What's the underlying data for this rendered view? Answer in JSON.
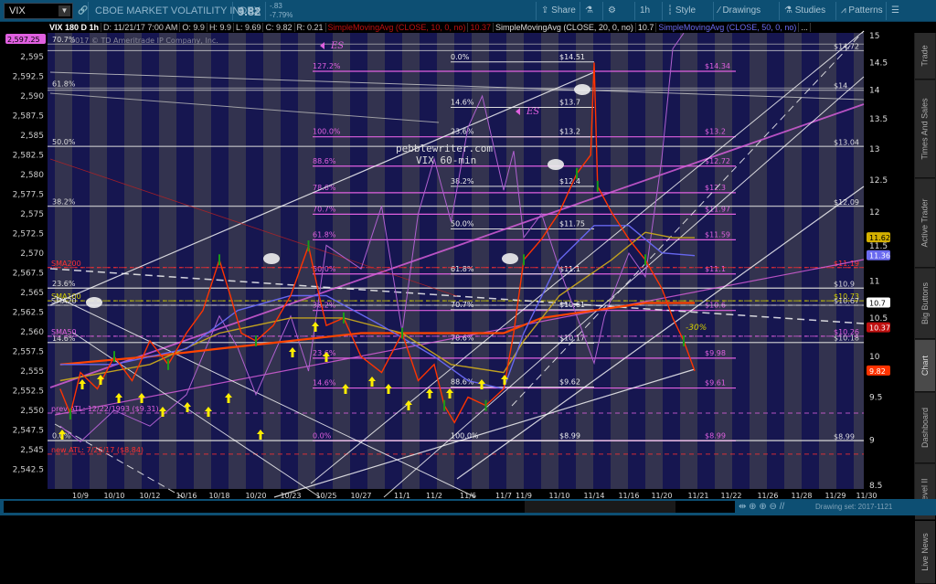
{
  "header": {
    "symbol": "VIX",
    "name": "CBOE MARKET VOLATILITY INDEX",
    "last": "9.82",
    "change": "-.83",
    "change_pct": "-7.79%",
    "buttons": [
      {
        "label": "Share",
        "icon": "share-icon"
      },
      {
        "label": "",
        "icon": "flask-icon"
      },
      {
        "label": "",
        "icon": "gear-icon"
      },
      {
        "label": "1h",
        "icon": ""
      },
      {
        "label": "Style",
        "icon": "candle-icon"
      },
      {
        "label": "Drawings",
        "icon": "pencil-icon"
      },
      {
        "label": "Studies",
        "icon": "flask-icon"
      },
      {
        "label": "Patterns",
        "icon": "pattern-icon"
      },
      {
        "label": "",
        "icon": "menu-icon"
      }
    ]
  },
  "infobar": {
    "title": "VIX 180 D 1h",
    "date": "D: 11/21/17 7:00 AM",
    "open": "O: 9.9",
    "high": "H: 9.9",
    "low": "L: 9.69",
    "close": "C: 9.82",
    "range": "R: 0.21",
    "study1": "SimpleMovingAvg (CLOSE, 10, 0, no)",
    "study1_val": "10.37",
    "study2": "SimpleMovingAvg (CLOSE, 20, 0, no)",
    "study2_val": "10.7",
    "study3": "SimpleMovingAvg (CLOSE, 50, 0, no)",
    "more": "..."
  },
  "copyright": "2017 © TD Ameritrade IP Company, Inc.",
  "sidebar": {
    "tabs": [
      "Trade",
      "Times And Sales",
      "Active Trader",
      "Big Buttons",
      "Chart",
      "Dashboard",
      "Level II",
      "Live News"
    ],
    "selected": "Chart"
  },
  "footer": {
    "drawing_set": "Drawing set: 2017-1121"
  },
  "colors": {
    "bg": "#1a1a4a",
    "stripe": "#33334f",
    "magenta": "#e060e0",
    "fib": "#dddddd",
    "price": "#ff3300",
    "sma10": "#cc1111",
    "sma20": "#cccccc",
    "sma50": "#6666ee",
    "sma100": "#c0a020"
  },
  "chart_data": {
    "type": "line",
    "title": "pebblewriter.com",
    "subtitle": "VIX 60-min",
    "right_axis": {
      "label": "VIX",
      "ticks": [
        "15",
        "14.5",
        "14",
        "13.5",
        "13",
        "12.5",
        "12",
        "11.5",
        "11",
        "10.5",
        "10",
        "9.5",
        "9",
        "8.5"
      ],
      "range": [
        8.5,
        15
      ],
      "scale": "log"
    },
    "left_axis": {
      "label": "ES",
      "ticks": [
        "2,595",
        "2,592.5",
        "2,590",
        "2,587.5",
        "2,585",
        "2,582.5",
        "2,580",
        "2,577.5",
        "2,575",
        "2,572.5",
        "2,570",
        "2,567.5",
        "2,565",
        "2,562.5",
        "2,560",
        "2,557.5",
        "2,555",
        "2,552.5",
        "2,550",
        "2,547.5",
        "2,545",
        "2,542.5"
      ],
      "range": [
        2542.5,
        2597.25
      ]
    },
    "x_ticks": [
      "10/9",
      "10/10",
      "10/12",
      "10/16",
      "10/18",
      "10/20",
      "10/23",
      "10/25",
      "10/27",
      "11/1",
      "11/2",
      "11/6",
      "11/7",
      "11/9",
      "11/10",
      "11/14",
      "11/16",
      "11/20",
      "11/21",
      "11/22",
      "11/26",
      "11/28",
      "11/29",
      "11/30"
    ],
    "badges": [
      {
        "text": "11.62",
        "v": 11.62,
        "color": "#d4b000",
        "fg": "#000"
      },
      {
        "text": "11.36",
        "v": 11.36,
        "color": "#6a6af0",
        "fg": "#fff"
      },
      {
        "text": "10.7",
        "v": 10.7,
        "color": "#ffffff",
        "fg": "#000"
      },
      {
        "text": "10.37",
        "v": 10.37,
        "color": "#c01010",
        "fg": "#fff"
      },
      {
        "text": "9.82",
        "v": 9.82,
        "color": "#ff3300",
        "fg": "#fff"
      }
    ],
    "left_badge": "2,597.25",
    "vix_fib": [
      {
        "pct": "0.0%",
        "price": "$14.51",
        "v": 14.51
      },
      {
        "pct": "14.6%",
        "price": "$13.7",
        "v": 13.7
      },
      {
        "pct": "23.6%",
        "price": "$13.2",
        "v": 13.2
      },
      {
        "pct": "38.2%",
        "price": "$12.4",
        "v": 12.4
      },
      {
        "pct": "50.0%",
        "price": "$11.75",
        "v": 11.75
      },
      {
        "pct": "61.8%",
        "price": "$11.1",
        "v": 11.1
      },
      {
        "pct": "70.7%",
        "price": "$10.61",
        "v": 10.61
      },
      {
        "pct": "78.6%",
        "price": "$10.17",
        "v": 10.17
      },
      {
        "pct": "88.6%",
        "price": "$9.62",
        "v": 9.62
      },
      {
        "pct": "100.0%",
        "price": "$8.99",
        "v": 8.99
      }
    ],
    "es_fib_ext": [
      {
        "pct": "127.2%",
        "price": "$14.34",
        "v": 14.34
      },
      {
        "pct": "100.0%",
        "price": "$13.2",
        "v": 13.2
      },
      {
        "pct": "88.6%",
        "price": "$12.72",
        "v": 12.72
      },
      {
        "pct": "78.6%",
        "price": "$12.3",
        "v": 12.3
      },
      {
        "pct": "70.7%",
        "price": "$11.97",
        "v": 11.97
      },
      {
        "pct": "61.8%",
        "price": "$11.59",
        "v": 11.59
      },
      {
        "pct": "50.0%",
        "price": "$11.1",
        "v": 11.1
      },
      {
        "pct": "38.2%",
        "price": "$10.6",
        "v": 10.6
      },
      {
        "pct": "23.6%",
        "price": "$9.98",
        "v": 9.98
      },
      {
        "pct": "14.6%",
        "price": "$9.61",
        "v": 9.61
      },
      {
        "pct": "0.0%",
        "price": "$8.99",
        "v": 8.99
      }
    ],
    "es_fib_left": [
      {
        "pct": "70.7%",
        "es": 2596.6
      },
      {
        "pct": "61.8%",
        "es": 2591
      },
      {
        "pct": "50.0%",
        "es": 2583.6
      },
      {
        "pct": "38.2%",
        "es": 2576
      },
      {
        "pct": "23.6%",
        "es": 2565.6
      },
      {
        "pct": "14.6%",
        "es": 2558.6
      },
      {
        "pct": "0.0%",
        "es": 2546.2
      }
    ],
    "right_levels": [
      {
        "text": "$14.72",
        "v": 14.72,
        "color": "#dddddd"
      },
      {
        "text": "$14",
        "v": 14,
        "color": "#dddddd"
      },
      {
        "text": "$13.04",
        "v": 13.04,
        "color": "#dddddd"
      },
      {
        "text": "$12.09",
        "v": 12.09,
        "color": "#dddddd"
      },
      {
        "text": "$11.19",
        "v": 11.19,
        "color": "#ff3030"
      },
      {
        "text": "$10.9",
        "v": 10.9,
        "color": "#dddddd"
      },
      {
        "text": "$10.73",
        "v": 10.73,
        "color": "#d4d000"
      },
      {
        "text": "$10.67",
        "v": 10.67,
        "color": "#dddddd"
      },
      {
        "text": "$10.26",
        "v": 10.26,
        "color": "#e060e0"
      },
      {
        "text": "$10.18",
        "v": 10.18,
        "color": "#dddddd"
      },
      {
        "text": "$8.99",
        "v": 8.99,
        "color": "#dddddd"
      }
    ],
    "left_levels": [
      {
        "text": "SMA200",
        "v": 11.19,
        "color": "#ff3030"
      },
      {
        "text": "SMA100",
        "v": 10.73,
        "color": "#d4d000"
      },
      {
        "text": "SMA20",
        "v": 10.67,
        "color": "#dddddd"
      },
      {
        "text": "SMA50",
        "v": 10.26,
        "color": "#e060e0"
      },
      {
        "text": "prev ATL: 12/22/1993 ($9.31)",
        "v": 9.31,
        "color": "#e060e0"
      },
      {
        "text": "new ATL: 7/26/17 ($8.84)",
        "v": 8.84,
        "color": "#ff3030"
      }
    ],
    "annotations": {
      "es_label": "ES",
      "pct_drop": "-30%"
    },
    "vix_path": [
      [
        -0.6,
        9.6
      ],
      [
        -0.3,
        9.3
      ],
      [
        0,
        9.8
      ],
      [
        0.5,
        9.6
      ],
      [
        1,
        10.0
      ],
      [
        1.5,
        9.7
      ],
      [
        2,
        10.2
      ],
      [
        2.5,
        9.9
      ],
      [
        3,
        10.3
      ],
      [
        3.5,
        10.6
      ],
      [
        4,
        11.3
      ],
      [
        4.3,
        10.8
      ],
      [
        4.6,
        10.3
      ],
      [
        5,
        10.2
      ],
      [
        5.5,
        10.4
      ],
      [
        6,
        10.8
      ],
      [
        6.5,
        11.5
      ],
      [
        6.8,
        10.8
      ],
      [
        7,
        10.4
      ],
      [
        7.5,
        10.5
      ],
      [
        8,
        10.0
      ],
      [
        8.5,
        9.8
      ],
      [
        9,
        10.3
      ],
      [
        9.5,
        9.7
      ],
      [
        10,
        9.9
      ],
      [
        10.3,
        9.4
      ],
      [
        10.6,
        9.2
      ],
      [
        11,
        9.5
      ],
      [
        11.5,
        9.4
      ],
      [
        12,
        9.6
      ],
      [
        12.5,
        10.3
      ],
      [
        13,
        11.3
      ],
      [
        13.5,
        11.6
      ],
      [
        14,
        12.0
      ],
      [
        14.5,
        12.6
      ],
      [
        14.9,
        12.9
      ],
      [
        15,
        14.5
      ],
      [
        15.1,
        12.4
      ],
      [
        15.5,
        12.0
      ],
      [
        16,
        11.6
      ],
      [
        16.5,
        11.3
      ],
      [
        17,
        10.9
      ],
      [
        17.3,
        10.5
      ],
      [
        17.6,
        10.2
      ],
      [
        17.9,
        9.82
      ]
    ],
    "sma50_path": [
      [
        -0.6,
        9.9
      ],
      [
        1,
        9.9
      ],
      [
        3,
        10.1
      ],
      [
        4.5,
        10.6
      ],
      [
        6,
        10.8
      ],
      [
        7,
        10.8
      ],
      [
        8.5,
        10.4
      ],
      [
        10,
        10.0
      ],
      [
        11,
        9.7
      ],
      [
        12,
        9.6
      ],
      [
        13,
        10.3
      ],
      [
        14,
        11.3
      ],
      [
        15,
        11.8
      ],
      [
        16,
        11.8
      ],
      [
        17,
        11.4
      ],
      [
        17.9,
        11.36
      ]
    ],
    "sma100_path": [
      [
        -0.6,
        9.7
      ],
      [
        2,
        9.9
      ],
      [
        4,
        10.3
      ],
      [
        6,
        10.5
      ],
      [
        7.5,
        10.5
      ],
      [
        9,
        10.3
      ],
      [
        10.5,
        9.9
      ],
      [
        12,
        9.8
      ],
      [
        13,
        10.2
      ],
      [
        14,
        10.8
      ],
      [
        15.5,
        11.3
      ],
      [
        16.5,
        11.7
      ],
      [
        17.3,
        11.62
      ],
      [
        17.9,
        11.62
      ]
    ],
    "sma200_path": [
      [
        -0.6,
        9.9
      ],
      [
        2,
        10.0
      ],
      [
        4,
        10.1
      ],
      [
        6,
        10.2
      ],
      [
        8,
        10.3
      ],
      [
        10,
        10.3
      ],
      [
        12,
        10.3
      ],
      [
        13.5,
        10.5
      ],
      [
        15,
        10.6
      ],
      [
        16.5,
        10.7
      ],
      [
        17.9,
        10.7
      ]
    ],
    "es_path": [
      [
        -0.6,
        2548
      ],
      [
        0,
        2546
      ],
      [
        1,
        2550
      ],
      [
        2,
        2548
      ],
      [
        3,
        2552
      ],
      [
        4,
        2562
      ],
      [
        4.5,
        2558
      ],
      [
        5,
        2552
      ],
      [
        6,
        2562
      ],
      [
        6.5,
        2555
      ],
      [
        7,
        2571
      ],
      [
        8,
        2568
      ],
      [
        8.5,
        2576
      ],
      [
        9,
        2560
      ],
      [
        9.5,
        2575
      ],
      [
        10,
        2582
      ],
      [
        10.5,
        2574
      ],
      [
        11,
        2586
      ],
      [
        11.4,
        2590
      ],
      [
        12,
        2578
      ],
      [
        12.5,
        2583
      ],
      [
        13,
        2572
      ],
      [
        13.5,
        2575
      ],
      [
        14,
        2568
      ],
      [
        14.5,
        2562
      ],
      [
        15,
        2556
      ],
      [
        15.3,
        2562
      ],
      [
        16,
        2570
      ],
      [
        16.5,
        2567
      ],
      [
        17,
        2582
      ],
      [
        17.3,
        2596
      ],
      [
        17.6,
        2598
      ]
    ]
  }
}
